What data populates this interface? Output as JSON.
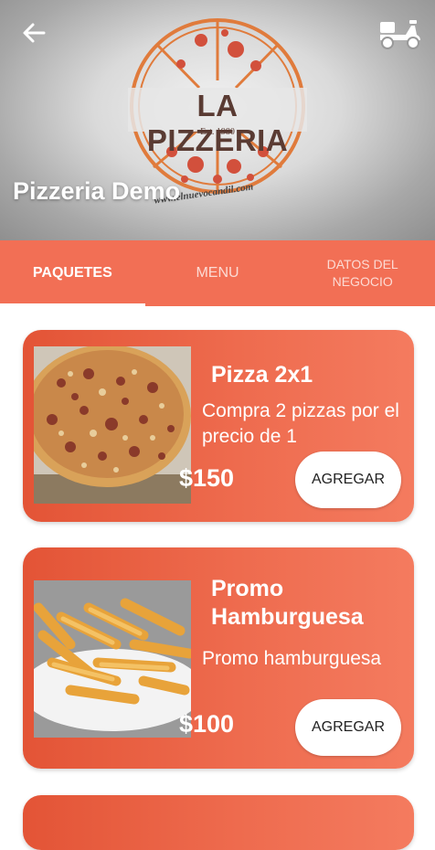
{
  "header": {
    "store_name": "Pizzeria Demo",
    "logo_text": "LA PIZZERIA",
    "logo_est": "— Est. 1980 —",
    "logo_url": "www.elnuevocandil.com",
    "back_icon": "arrow-left-icon",
    "delivery_icon": "motorcycle-icon"
  },
  "tabs": [
    {
      "label": "PAQUETES",
      "active": true
    },
    {
      "label": "MENU",
      "active": false
    },
    {
      "label": "DATOS DEL NEGOCIO",
      "active": false
    }
  ],
  "packages": [
    {
      "title": "Pizza 2x1",
      "description": "Compra 2 pizzas por el precio de 1",
      "price": "$150",
      "button": "AGREGAR",
      "image": "pizza-image"
    },
    {
      "title": "Promo Hamburguesa",
      "description": "Promo hamburguesa",
      "price": "$100",
      "button": "AGREGAR",
      "image": "fries-image"
    }
  ],
  "colors": {
    "accent": "#f26f55",
    "card": "#ee6b4e"
  }
}
